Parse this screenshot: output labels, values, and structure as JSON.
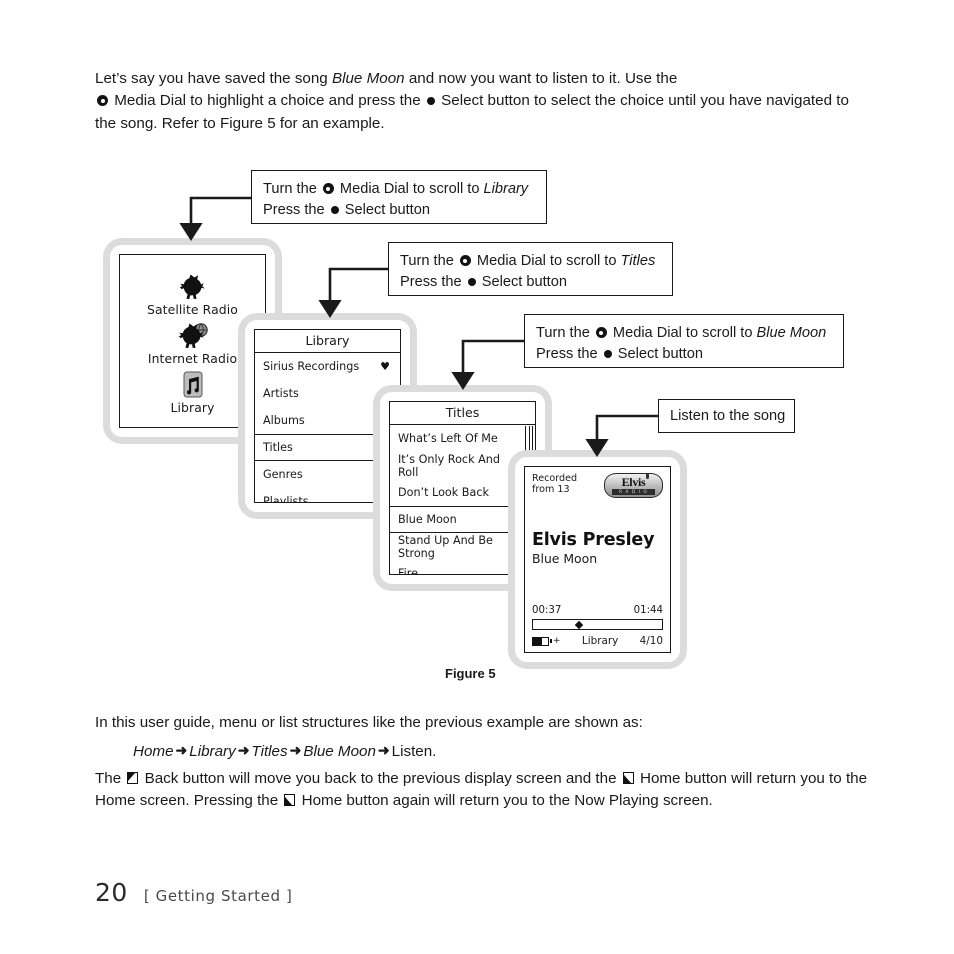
{
  "intro": {
    "part1": "Let’s say you have saved the song ",
    "song": "Blue Moon",
    "part2": " and now you want to listen to it. Use the",
    "part3": " Media Dial to highlight a choice and press the ",
    "part4": " Select button to select the choice until you have navigated to the song. Refer to Figure 5 for an example."
  },
  "callouts": {
    "library": {
      "line1_a": "Turn the ",
      "line1_b": " Media Dial to scroll to ",
      "target": "Library",
      "line2_a": "Press the ",
      "line2_b": " Select button"
    },
    "titles": {
      "line1_a": "Turn the ",
      "line1_b": " Media Dial to scroll to ",
      "target": "Titles",
      "line2_a": "Press the ",
      "line2_b": " Select button"
    },
    "bluemoon": {
      "line1_a": "Turn the ",
      "line1_b": " Media Dial to scroll to ",
      "target": "Blue Moon",
      "line2_a": "Press the ",
      "line2_b": " Select button"
    },
    "listen": {
      "text": "Listen to the song"
    }
  },
  "screens": {
    "home": {
      "items": [
        {
          "label": "Satellite Radio",
          "icon": "sirius-dog-icon"
        },
        {
          "label": "Internet Radio",
          "icon": "sirius-dog-globe-icon"
        },
        {
          "label": "Library",
          "icon": "music-note-icon"
        }
      ]
    },
    "library": {
      "title": "Library",
      "rows": [
        {
          "label": "Sirius Recordings",
          "heart": "♥",
          "selected": false
        },
        {
          "label": "Artists",
          "heart": "",
          "selected": false
        },
        {
          "label": "Albums",
          "heart": "",
          "selected": false
        },
        {
          "label": "Titles",
          "heart": "",
          "selected": true
        },
        {
          "label": "Genres",
          "heart": "",
          "selected": false
        },
        {
          "label": "Playlists",
          "heart": "",
          "selected": false
        }
      ]
    },
    "titles": {
      "title": "Titles",
      "rows": [
        {
          "label": "What’s Left Of Me",
          "heart": "",
          "selected": false
        },
        {
          "label": "It’s Only Rock And Roll",
          "heart": "♥",
          "selected": false
        },
        {
          "label": "Don’t Look Back",
          "heart": "",
          "selected": false
        },
        {
          "label": "Blue Moon",
          "heart": "",
          "selected": true
        },
        {
          "label": "Stand Up And Be Strong",
          "heart": "",
          "selected": false
        },
        {
          "label": "Fire",
          "heart": "",
          "selected": false
        }
      ]
    },
    "now_playing": {
      "recorded_line1": "Recorded",
      "recorded_line2": "from 13",
      "logo_word": "Elvis",
      "logo_sub": "R A D I O",
      "artist": "Elvis Presley",
      "song": "Blue Moon",
      "elapsed": "00:37",
      "duration": "01:44",
      "source": "Library",
      "track_position": "4/10",
      "battery_plus": "+"
    }
  },
  "figure": {
    "caption": "Figure 5"
  },
  "guide": {
    "intro": "In this user guide, menu or list structures like the previous example are shown as:",
    "path": [
      "Home",
      "Library",
      "Titles",
      "Blue Moon",
      "Listen."
    ],
    "arrow": "➜",
    "buttons_a": "The ",
    "buttons_b": " Back button will move you back to the previous display screen and the ",
    "buttons_c": " Home button will return you to the Home screen. Pressing the ",
    "buttons_d": " Home button again will return you to the Now Playing screen."
  },
  "footer": {
    "page_number": "20",
    "section": "[ Getting Started ]"
  },
  "colors": {
    "text": "#1a1a1a",
    "bezel": "#dcdcdc",
    "background": "#ffffff"
  }
}
